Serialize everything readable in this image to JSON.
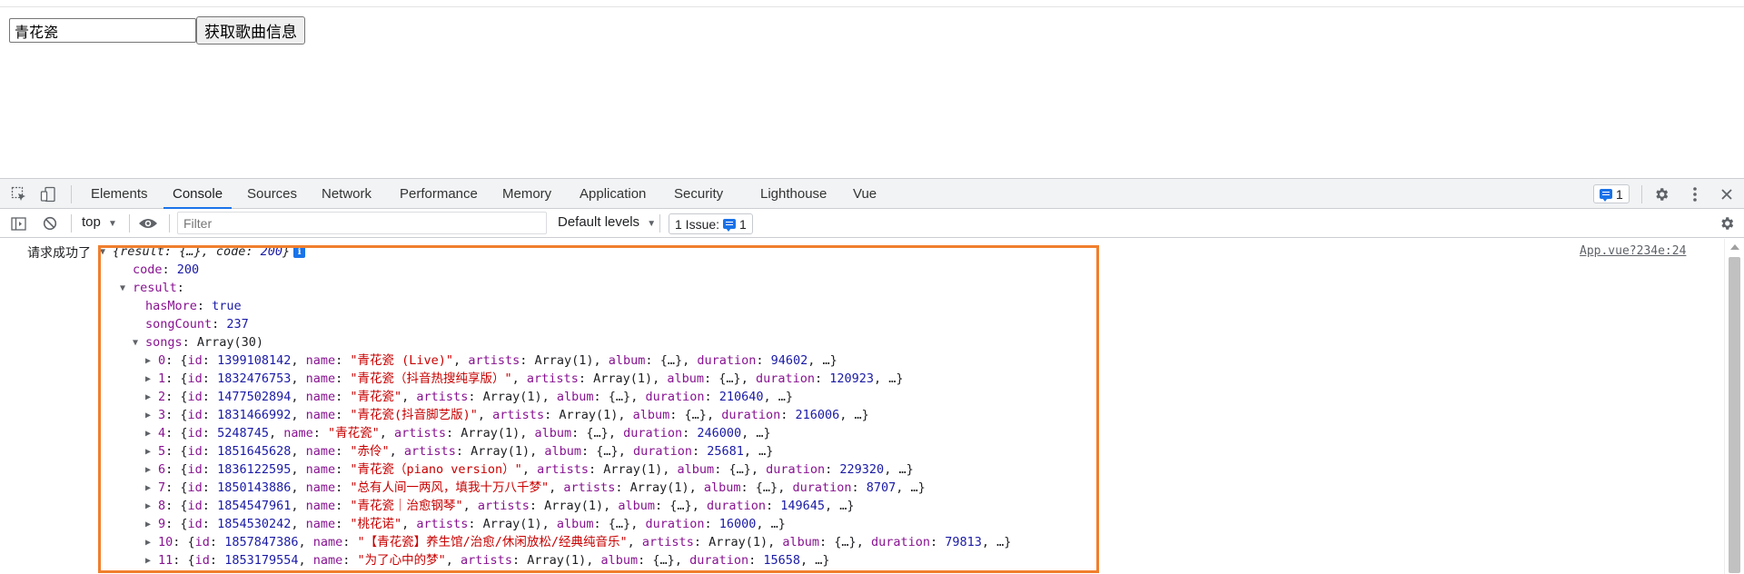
{
  "page": {
    "search_value": "青花瓷",
    "fetch_button": "获取歌曲信息"
  },
  "devtools": {
    "tabs": [
      "Elements",
      "Console",
      "Sources",
      "Network",
      "Performance",
      "Memory",
      "Application",
      "Security",
      "Lighthouse",
      "Vue"
    ],
    "active_tab": "Console",
    "issues_count": "1",
    "toolbar": {
      "context": "top",
      "filter_placeholder": "Filter",
      "levels": "Default levels",
      "issue_label": "1 Issue:",
      "issue_count": "1"
    },
    "log": {
      "message": "请求成功了",
      "source": "App.vue?234e:24",
      "preview_key1": "result",
      "preview_val1": "{…}",
      "preview_key2": "code",
      "preview_val2": "200",
      "code_key": "code",
      "code_value": "200",
      "result_key": "result",
      "hasMore_key": "hasMore",
      "hasMore_value": "true",
      "songCount_key": "songCount",
      "songCount_value": "237",
      "songs_key": "songs",
      "songs_value": "Array(30)",
      "songs": [
        {
          "index": "0",
          "id": "1399108142",
          "name": "\"青花瓷 (Live)\"",
          "duration": "94602"
        },
        {
          "index": "1",
          "id": "1832476753",
          "name": "\"青花瓷（抖音热搜纯享版）\"",
          "duration": "120923"
        },
        {
          "index": "2",
          "id": "1477502894",
          "name": "\"青花瓷\"",
          "duration": "210640"
        },
        {
          "index": "3",
          "id": "1831466992",
          "name": "\"青花瓷(抖音脚艺版)\"",
          "duration": "216006"
        },
        {
          "index": "4",
          "id": "5248745",
          "name": "\"青花瓷\"",
          "duration": "246000"
        },
        {
          "index": "5",
          "id": "1851645628",
          "name": "\"赤伶\"",
          "duration": "25681"
        },
        {
          "index": "6",
          "id": "1836122595",
          "name": "\"青花瓷（piano version）\"",
          "duration": "229320"
        },
        {
          "index": "7",
          "id": "1850143886",
          "name": "\"总有人间一两风，填我十万八千梦\"",
          "duration": "8707"
        },
        {
          "index": "8",
          "id": "1854547961",
          "name": "\"青花瓷｜治愈钢琴\"",
          "duration": "149645"
        },
        {
          "index": "9",
          "id": "1854530242",
          "name": "\"桃花诺\"",
          "duration": "16000"
        },
        {
          "index": "10",
          "id": "1857847386",
          "name": "\"【青花瓷】养生馆/治愈/休闲放松/经典纯音乐\"",
          "duration": "79813"
        },
        {
          "index": "11",
          "id": "1853179554",
          "name": "\"为了心中的梦\"",
          "duration": "15658"
        }
      ],
      "artists_text": "Array(1)",
      "album_text": "{…}"
    }
  },
  "colors": {
    "highlight_border": "#f07f2d",
    "accent": "#1a73e8"
  }
}
